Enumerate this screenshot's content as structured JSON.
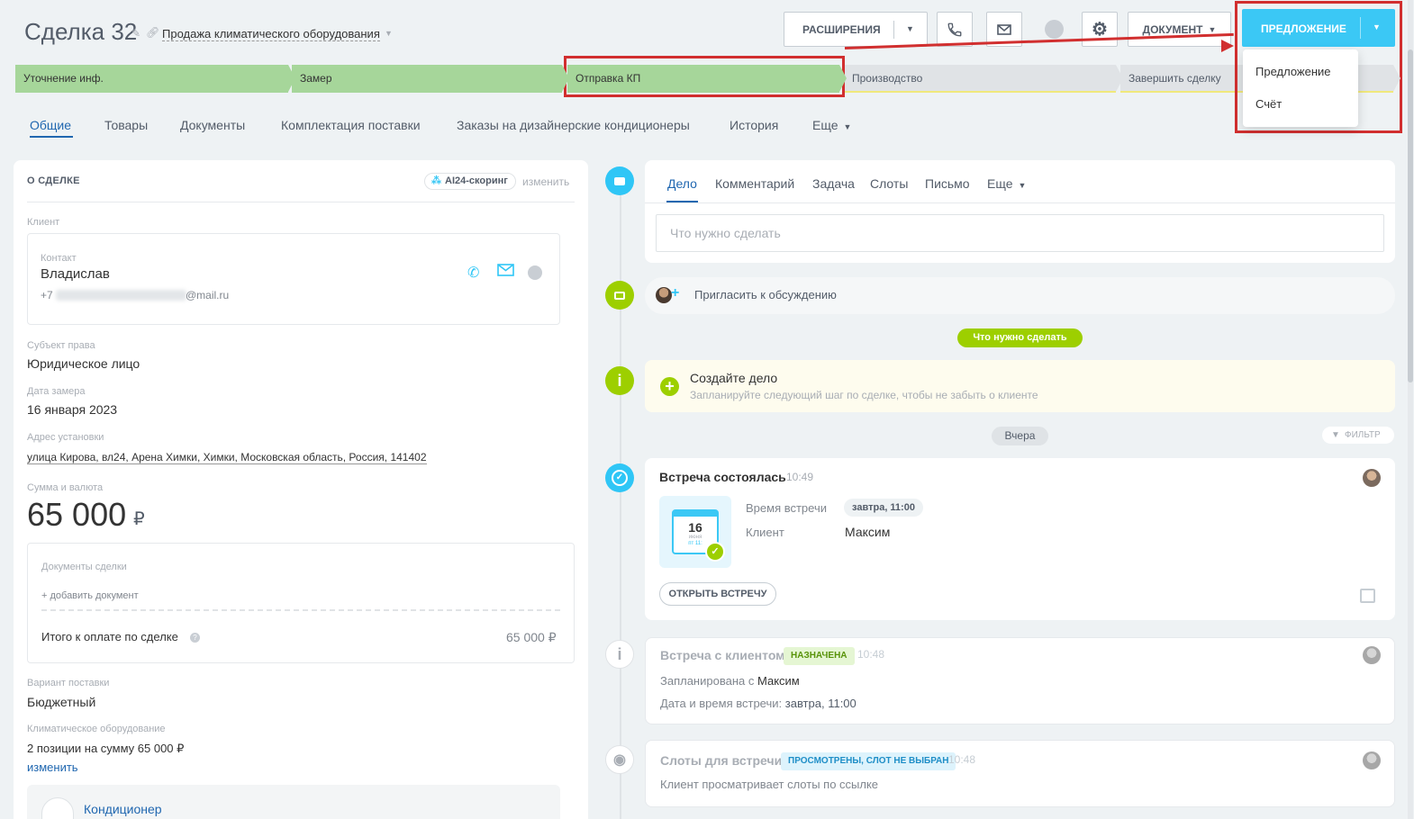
{
  "header": {
    "deal_title": "Сделка 32",
    "category": "Продажа климатического оборудования",
    "extensions_label": "РАСШИРЕНИЯ",
    "document_label": "ДОКУМЕНТ",
    "offer_label": "ПРЕДЛОЖЕНИЕ"
  },
  "offer_dropdown": {
    "items": [
      "Предложение",
      "Счёт"
    ]
  },
  "stages": [
    {
      "label": "Уточнение инф.",
      "state": "done"
    },
    {
      "label": "Замер",
      "state": "done"
    },
    {
      "label": "Отправка КП",
      "state": "current"
    },
    {
      "label": "Производство",
      "state": "todo"
    },
    {
      "label": "Завершить сделку",
      "state": "todo"
    }
  ],
  "tabs": [
    "Общие",
    "Товары",
    "Документы",
    "Комплектация поставки",
    "Заказы на дизайнерские кондиционеры",
    "История",
    "Еще"
  ],
  "about": {
    "title": "О СДЕЛКЕ",
    "ai_badge": "AI24-скоринг",
    "edit_link": "изменить",
    "client_label": "Клиент",
    "contact_label": "Контакт",
    "contact_name": "Владислав",
    "phone_prefix": "+7",
    "email_suffix": "@mail.ru",
    "subject_label": "Субъект права",
    "subject_value": "Юридическое лицо",
    "measure_label": "Дата замера",
    "measure_value": "16 января 2023",
    "address_label": "Адрес установки",
    "address_value": "улица Кирова, вл24, Арена Химки, Химки, Московская область, Россия, 141402",
    "sum_label": "Сумма и валюта",
    "sum_value": "65 000",
    "currency": "₽",
    "docs_label": "Документы сделки",
    "add_doc": "+ добавить документ",
    "total_label": "Итого к оплате по сделке",
    "total_value": "65 000 ₽",
    "delivery_label": "Вариант поставки",
    "delivery_value": "Бюджетный",
    "equipment_label": "Климатическое оборудование",
    "equipment_value": "2 позиции на сумму 65 000 ₽",
    "equipment_edit": "изменить",
    "product_name": "Кондиционер"
  },
  "timeline": {
    "tabs": [
      "Дело",
      "Комментарий",
      "Задача",
      "Слоты",
      "Письмо",
      "Еще"
    ],
    "todo_placeholder": "Что нужно сделать",
    "invite_text": "Пригласить к обсуждению",
    "todo_pill": "Что нужно сделать",
    "create_title": "Создайте дело",
    "create_desc": "Запланируйте следующий шаг по сделке, чтобы не забыть о клиенте",
    "yesterday": "Вчера",
    "filter": "ФИЛЬТР",
    "meet1": {
      "title": "Встреча состоялась",
      "time": "10:49",
      "cal_day": "16",
      "cal_month": "июня",
      "cal_wd": "пт 11:",
      "meet_time_label": "Время встречи",
      "meet_time_value": "завтра, 11:00",
      "client_label": "Клиент",
      "client_value": "Максим",
      "open_button": "ОТКРЫТЬ ВСТРЕЧУ"
    },
    "meet2": {
      "title": "Встреча с клиентом",
      "badge": "НАЗНАЧЕНА",
      "time": "10:48",
      "line1_prefix": "Запланирована с",
      "line1_name": "Максим",
      "line2_prefix": "Дата и время встречи:",
      "line2_value": "завтра, 11:00"
    },
    "slots": {
      "title": "Слоты для встречи",
      "badge": "ПРОСМОТРЕНЫ, СЛОТ НЕ ВЫБРАН",
      "time": "10:48",
      "desc": "Клиент просматривает слоты по ссылке"
    }
  },
  "colors": {
    "accent": "#3bc8f5",
    "stage_done": "#a6d69a",
    "highlight": "#d12f2f",
    "green": "#9dcf00",
    "link": "#2067b0"
  }
}
